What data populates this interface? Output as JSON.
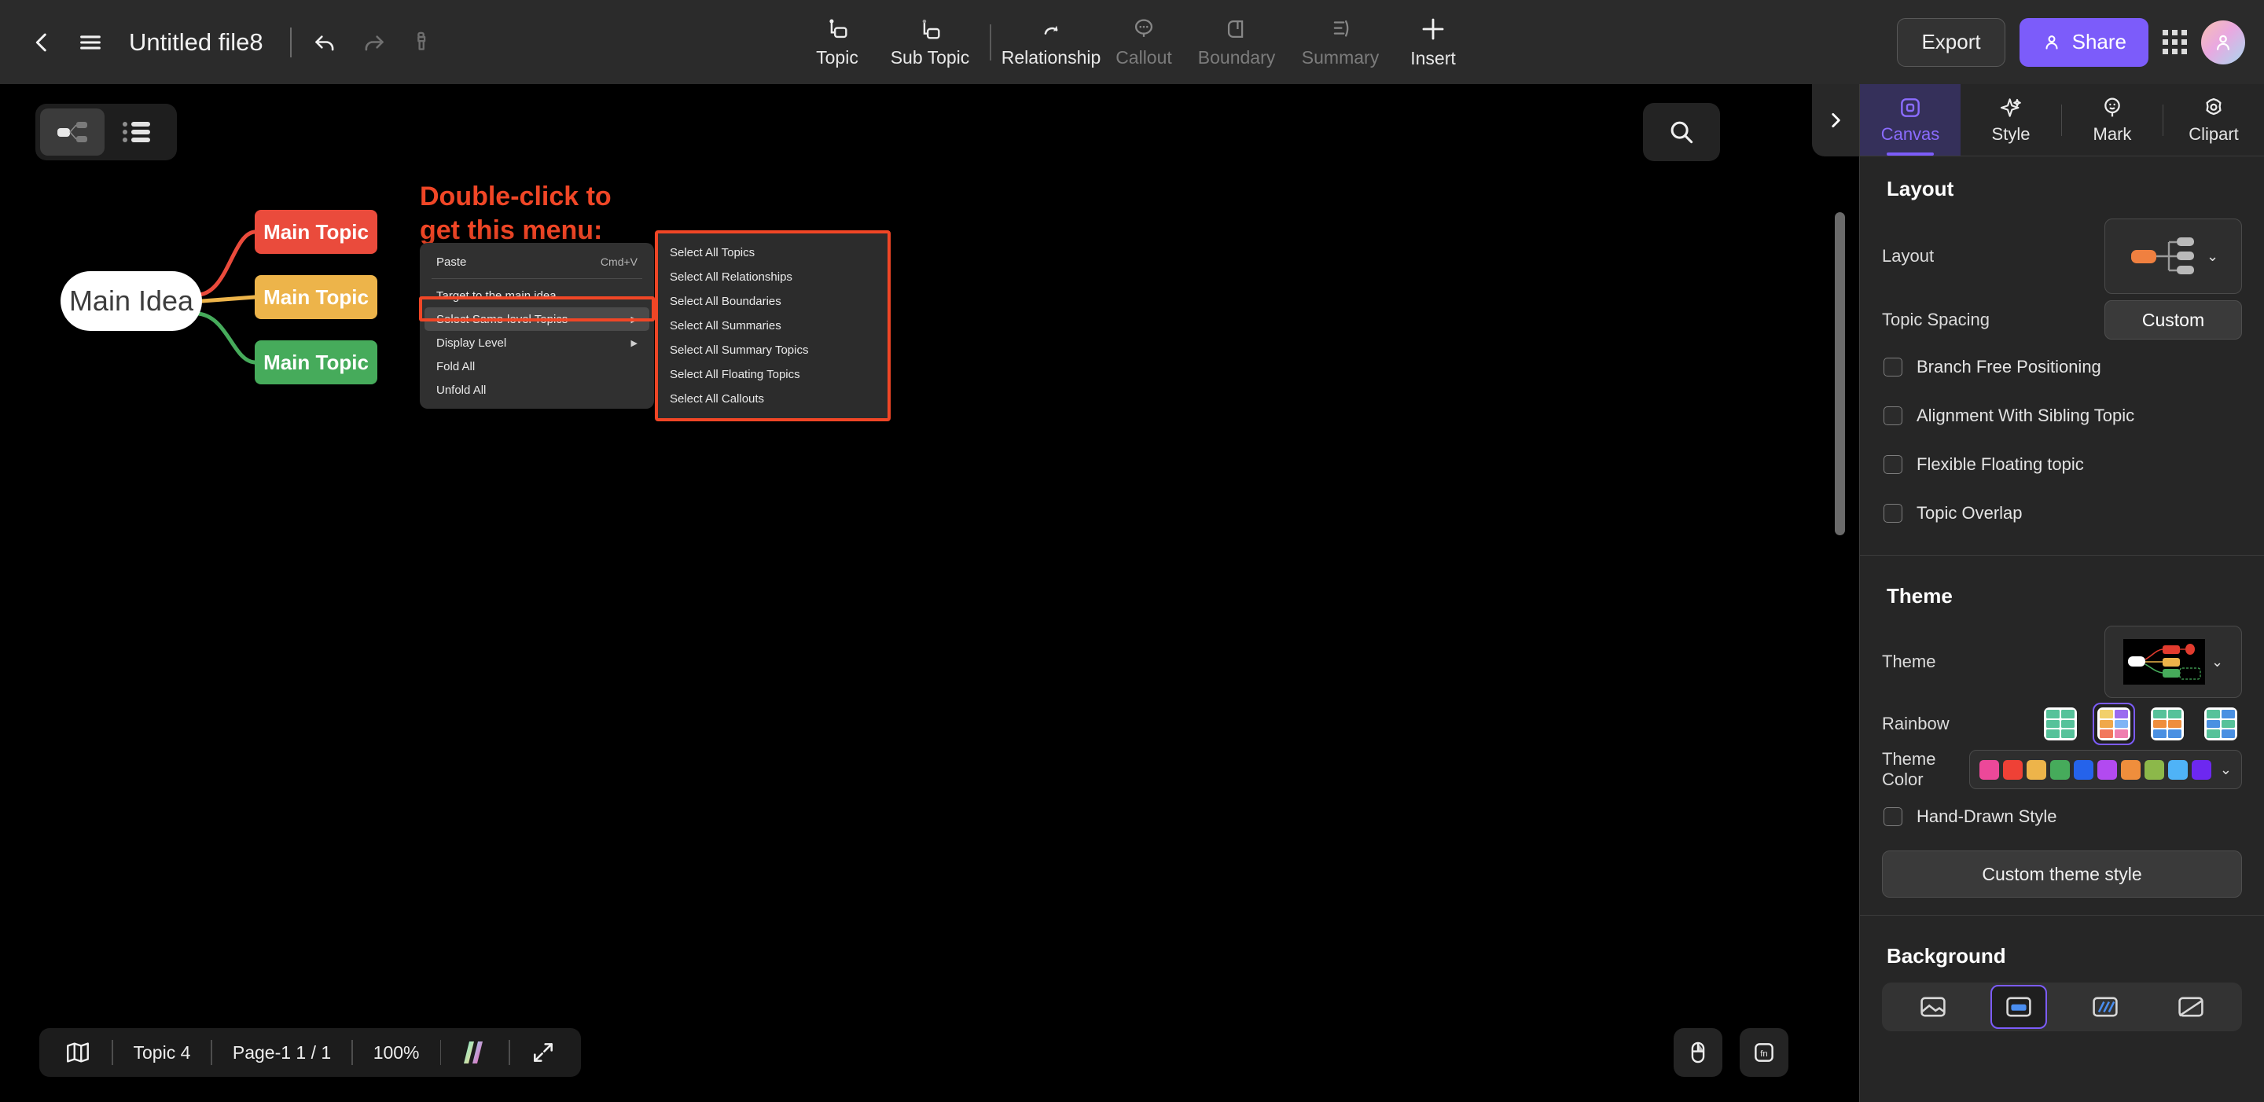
{
  "topbar": {
    "back_icon": "chevron-left-icon",
    "menu_icon": "hamburger-menu-icon",
    "title": "Untitled file8",
    "undo_icon": "undo-icon",
    "redo_icon": "redo-icon",
    "format_painter_icon": "format-painter-icon",
    "tools": [
      {
        "label": "Topic",
        "icon": "topic-icon",
        "disabled": false
      },
      {
        "label": "Sub Topic",
        "icon": "sub-topic-icon",
        "disabled": false
      },
      {
        "label": "Relationship",
        "icon": "relationship-icon",
        "disabled": false
      },
      {
        "label": "Callout",
        "icon": "callout-icon",
        "disabled": true
      },
      {
        "label": "Boundary",
        "icon": "boundary-icon",
        "disabled": true
      },
      {
        "label": "Summary",
        "icon": "summary-icon",
        "disabled": true
      },
      {
        "label": "Insert",
        "icon": "plus-icon",
        "disabled": false
      }
    ],
    "export_label": "Export",
    "share_label": "Share",
    "apps_icon": "apps-grid-icon",
    "avatar_icon": "user-avatar"
  },
  "canvas": {
    "view_toggle": {
      "mindmap_icon": "mindmap-view-icon",
      "outline_icon": "outline-view-icon",
      "active": "mindmap"
    },
    "search_icon": "search-icon",
    "panel_toggle_icon": "chevron-right-icon",
    "annotation": {
      "line1": "Double-click to",
      "line2": "get this menu:",
      "color": "#f04626"
    },
    "mindmap": {
      "root": {
        "label": "Main Idea",
        "color": "#ffffff",
        "text_color": "#3d3d3d"
      },
      "topics": [
        {
          "label": "Main Topic",
          "color": "#ea4b3c"
        },
        {
          "label": "Main Topic",
          "color": "#edb44a"
        },
        {
          "label": "Main Topic",
          "color": "#46ab5b"
        }
      ]
    },
    "context_menu": {
      "items": [
        {
          "label": "Paste",
          "shortcut": "Cmd+V",
          "submenu": false,
          "highlighted": false
        },
        {
          "label": "Target to the main idea",
          "shortcut": "",
          "submenu": false,
          "highlighted": false
        },
        {
          "label": "Select Same-level Topics",
          "shortcut": "",
          "submenu": true,
          "highlighted": true
        },
        {
          "label": "Display Level",
          "shortcut": "",
          "submenu": true,
          "highlighted": false
        },
        {
          "label": "Fold All",
          "shortcut": "",
          "submenu": false,
          "highlighted": false
        },
        {
          "label": "Unfold All",
          "shortcut": "",
          "submenu": false,
          "highlighted": false
        }
      ]
    },
    "submenu": {
      "items": [
        "Select All Topics",
        "Select All Relationships",
        "Select All Boundaries",
        "Select All Summaries",
        "Select All Summary Topics",
        "Select All Floating Topics",
        "Select All Callouts"
      ]
    },
    "statusbar": {
      "map_icon": "map-overview-icon",
      "topic_count": "Topic 4",
      "page": "Page-1  1 / 1",
      "zoom": "100%",
      "brand_icon": "brand-logo-icon",
      "fullscreen_icon": "fullscreen-icon"
    },
    "fabs": [
      {
        "icon": "mouse-icon"
      },
      {
        "icon": "fn-key-icon"
      }
    ]
  },
  "right_panel": {
    "tabs": [
      {
        "label": "Canvas",
        "icon": "canvas-icon",
        "active": true
      },
      {
        "label": "Style",
        "icon": "sparkle-icon",
        "active": false
      },
      {
        "label": "Mark",
        "icon": "mark-pin-icon",
        "active": false
      },
      {
        "label": "Clipart",
        "icon": "clipart-icon",
        "active": false
      }
    ],
    "layout_section": {
      "title": "Layout",
      "layout_label": "Layout",
      "layout_value_icon": "right-map-layout-icon",
      "layout_accent": "#f08040",
      "topic_spacing_label": "Topic Spacing",
      "topic_spacing_value": "Custom",
      "checkboxes": [
        {
          "label": "Branch Free Positioning",
          "checked": false
        },
        {
          "label": "Alignment With Sibling Topic",
          "checked": false
        },
        {
          "label": "Flexible Floating topic",
          "checked": false
        },
        {
          "label": "Topic Overlap",
          "checked": false
        }
      ]
    },
    "theme_section": {
      "title": "Theme",
      "theme_label": "Theme",
      "theme_thumb_icon": "theme-preview-icon",
      "rainbow_label": "Rainbow",
      "rainbow_options": [
        {
          "name": "rainbow-mono-green",
          "selected": false,
          "colors": [
            "#56c29a",
            "#56c29a",
            "#56c29a",
            "#56c29a",
            "#56c29a",
            "#56c29a"
          ]
        },
        {
          "name": "rainbow-multi",
          "selected": true,
          "colors": [
            "#f2d06b",
            "#9b6cf0",
            "#f0a84a",
            "#7fb4f5",
            "#f2785c",
            "#ef7fb0"
          ]
        },
        {
          "name": "rainbow-green-orange-blue",
          "selected": false,
          "colors": [
            "#56c29a",
            "#56c29a",
            "#ef8e3c",
            "#ef8e3c",
            "#4a90e2",
            "#4a90e2"
          ]
        },
        {
          "name": "rainbow-green-blue",
          "selected": false,
          "colors": [
            "#56c29a",
            "#4a90e2",
            "#4a90e2",
            "#56c29a",
            "#56c29a",
            "#4a90e2"
          ]
        }
      ],
      "theme_color_label": "Theme Color",
      "theme_colors": [
        "#ec4899",
        "#ef4136",
        "#edb44a",
        "#46ab5b",
        "#2563eb",
        "#b24af0",
        "#ef8e3c",
        "#8cb84a",
        "#4fb3f7",
        "#6d28f0"
      ],
      "hand_drawn_label": "Hand-Drawn Style",
      "hand_drawn_checked": false,
      "custom_theme_label": "Custom theme style"
    },
    "background_section": {
      "title": "Background",
      "options": [
        {
          "name": "bg-image",
          "selected": false
        },
        {
          "name": "bg-color",
          "selected": true
        },
        {
          "name": "bg-pattern",
          "selected": false
        },
        {
          "name": "bg-gradient",
          "selected": false
        }
      ]
    }
  }
}
